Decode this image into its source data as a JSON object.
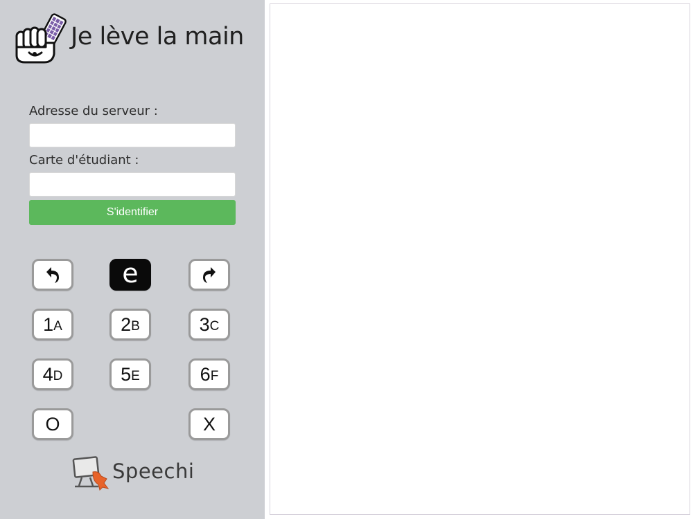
{
  "app": {
    "title": "Je lève la main",
    "brand": "Speechi"
  },
  "login": {
    "server_label": "Adresse du serveur :",
    "server_value": "",
    "card_label": "Carte d'étudiant :",
    "card_value": "",
    "submit_label": "S'identifier"
  },
  "keypad": {
    "undo_icon": "undo-arrow-icon",
    "e_label": "e",
    "redo_icon": "redo-arrow-icon",
    "keys": [
      {
        "digit": "1",
        "letter": "A"
      },
      {
        "digit": "2",
        "letter": "B"
      },
      {
        "digit": "3",
        "letter": "C"
      },
      {
        "digit": "4",
        "letter": "D"
      },
      {
        "digit": "5",
        "letter": "E"
      },
      {
        "digit": "6",
        "letter": "F"
      }
    ],
    "yes_label": "O",
    "no_label": "X"
  },
  "colors": {
    "sidebar_bg": "#cdcfd3",
    "button_green": "#5cb85c",
    "logo_purple": "#7b5ea8",
    "speechi_orange": "#e8632a"
  },
  "icons": {
    "logo": "raised-hand-clicker-icon",
    "brand": "speechi-monitor-icon"
  }
}
